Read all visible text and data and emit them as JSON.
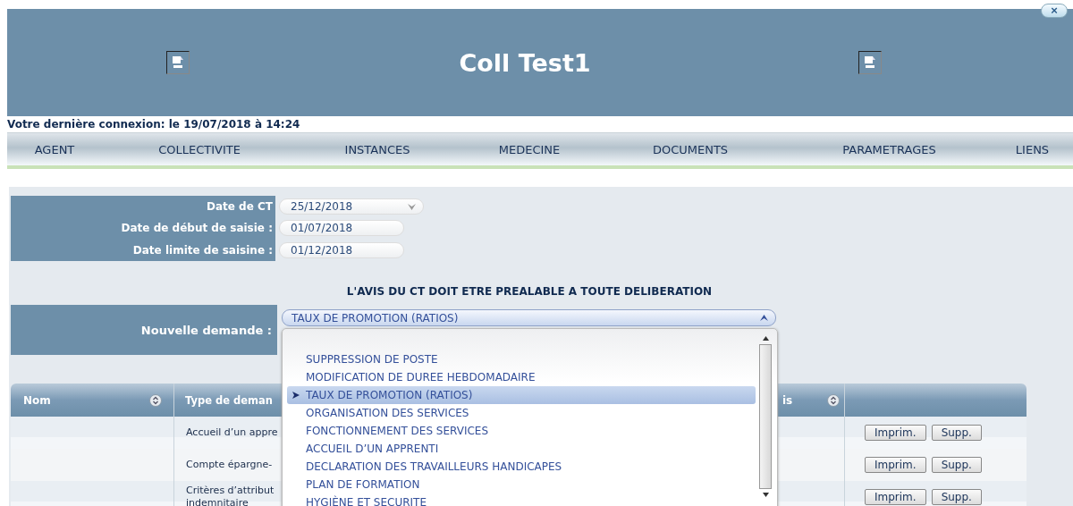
{
  "header": {
    "title": "Coll Test1",
    "close_label": "×"
  },
  "last_login": "Votre dernière connexion: le 19/07/2018 à 14:24",
  "nav": [
    {
      "label": "AGENT"
    },
    {
      "label": "COLLECTIVITE"
    },
    {
      "label": "INSTANCES"
    },
    {
      "label": "MEDECINE"
    },
    {
      "label": "DOCUMENTS"
    },
    {
      "label": "PARAMETRAGES"
    },
    {
      "label": "LIENS"
    }
  ],
  "dates": [
    {
      "label": "Date de CT",
      "value": "25/12/2018",
      "kind": "select"
    },
    {
      "label": "Date de début de saisie :",
      "value": "01/07/2018",
      "kind": "input"
    },
    {
      "label": "Date limite de saisine :",
      "value": "01/12/2018",
      "kind": "input"
    }
  ],
  "notice": "L'AVIS DU CT DOIT ETRE PREALABLE A TOUTE DELIBERATION",
  "new_request": {
    "label": "Nouvelle demande :",
    "value": "TAUX DE PROMOTION (RATIOS)",
    "options": [
      {
        "label": "SUPPRESSION DE POSTE",
        "selected": false
      },
      {
        "label": "MODIFICATION DE DUREE HEBDOMADAIRE",
        "selected": false
      },
      {
        "label": "TAUX DE PROMOTION (RATIOS)",
        "selected": true
      },
      {
        "label": "ORGANISATION DES SERVICES",
        "selected": false
      },
      {
        "label": "FONCTIONNEMENT DES SERVICES",
        "selected": false
      },
      {
        "label": "ACCUEIL D’UN APPRENTI",
        "selected": false
      },
      {
        "label": "DECLARATION DES TRAVAILLEURS HANDICAPES",
        "selected": false
      },
      {
        "label": "PLAN DE FORMATION",
        "selected": false
      },
      {
        "label": "HYGIÈNE ET SECURITE",
        "selected": false
      }
    ]
  },
  "table": {
    "columns": [
      {
        "label": "Nom"
      },
      {
        "label": "Type de deman"
      },
      {
        "label": "is"
      }
    ],
    "rows": [
      {
        "type": "Accueil d’un appre",
        "actions": [
          "Imprim.",
          "Supp."
        ]
      },
      {
        "type": "Compte épargne-",
        "actions": [
          "Imprim.",
          "Supp."
        ]
      },
      {
        "type": "Critères d’attribut\nindemnitaire",
        "actions": [
          "Imprim.",
          "Supp."
        ]
      }
    ]
  }
}
